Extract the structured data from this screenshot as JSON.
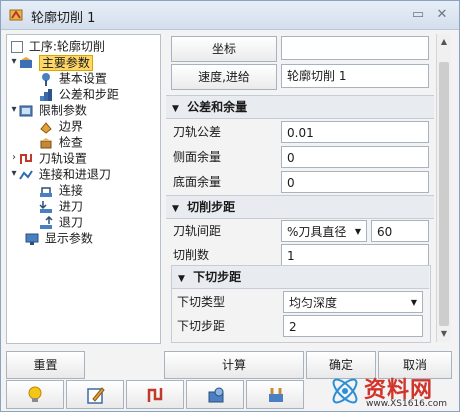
{
  "window": {
    "title": "轮廓切削 1"
  },
  "tree": [
    {
      "label": "工序:轮廓切削"
    },
    {
      "label": "主要参数"
    },
    {
      "label": "基本设置"
    },
    {
      "label": "公差和步距"
    },
    {
      "label": "限制参数"
    },
    {
      "label": "边界"
    },
    {
      "label": "检查"
    },
    {
      "label": "刀轨设置"
    },
    {
      "label": "连接和进退刀"
    },
    {
      "label": "连接"
    },
    {
      "label": "进刀"
    },
    {
      "label": "退刀"
    },
    {
      "label": "显示参数"
    }
  ],
  "top": {
    "coord_button": "坐标",
    "coord_value": "",
    "speed_button": "速度,进给",
    "speed_value": "轮廓切削 1"
  },
  "tolerance": {
    "header": "公差和余量",
    "rows": [
      {
        "label": "刀轨公差",
        "value": "0.01"
      },
      {
        "label": "侧面余量",
        "value": "0"
      },
      {
        "label": "底面余量",
        "value": "0"
      }
    ]
  },
  "stepover": {
    "header": "切削步距",
    "path_spacing_label": "刀轨间距",
    "path_spacing_mode": "%刀具直径",
    "path_spacing_value": "60",
    "cut_count_label": "切削数",
    "cut_count_value": "1"
  },
  "stepdown": {
    "header": "下切步距",
    "type_label": "下切类型",
    "type_value": "均匀深度",
    "step_label": "下切步距",
    "step_value": "2"
  },
  "buttons": {
    "reset": "重置",
    "calculate": "计算",
    "ok": "确定",
    "cancel": "取消"
  },
  "watermark": {
    "text": "资料网",
    "url": "www.XS1616.com"
  }
}
